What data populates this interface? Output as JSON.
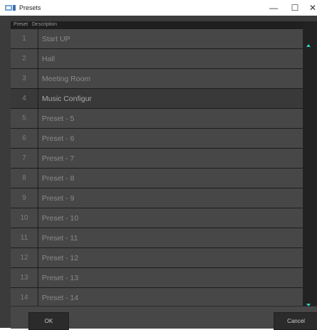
{
  "window": {
    "title": "Presets",
    "icon": "presets-app-icon",
    "controls": {
      "minimize": "—",
      "maximize": "☐",
      "close": "✕"
    }
  },
  "table": {
    "columns": {
      "preset": "Preset",
      "description": "Description"
    },
    "rows": [
      {
        "num": "1",
        "desc": "Start UP"
      },
      {
        "num": "2",
        "desc": "Hall"
      },
      {
        "num": "3",
        "desc": "Meeting Room"
      },
      {
        "num": "4",
        "desc": "Music Configur",
        "selected": true
      },
      {
        "num": "5",
        "desc": "Preset - 5"
      },
      {
        "num": "6",
        "desc": "Preset - 6"
      },
      {
        "num": "7",
        "desc": "Preset - 7"
      },
      {
        "num": "8",
        "desc": "Preset - 8"
      },
      {
        "num": "9",
        "desc": "Preset - 9"
      },
      {
        "num": "10",
        "desc": "Preset - 10"
      },
      {
        "num": "11",
        "desc": "Preset - 11"
      },
      {
        "num": "12",
        "desc": "Preset - 12"
      },
      {
        "num": "13",
        "desc": "Preset - 13"
      },
      {
        "num": "14",
        "desc": "Preset - 14"
      }
    ]
  },
  "buttons": {
    "ok": "OK",
    "cancel": "Cancel"
  },
  "colors": {
    "accent": "#2fd3c1",
    "background": "#3b3b3b"
  }
}
